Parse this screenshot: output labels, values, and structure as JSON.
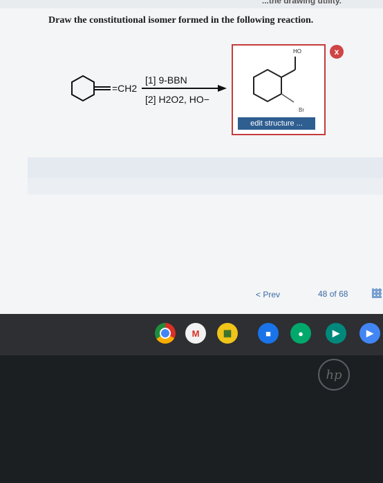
{
  "top_strip": {
    "text": "...the drawing utility."
  },
  "question": "Draw the constitutional isomer formed in the following reaction.",
  "reaction": {
    "reactant_label": "=CH2",
    "reagent_step1": "[1] 9-BBN",
    "reagent_step2": "[2] H2O2, HO−"
  },
  "answer": {
    "label_ho": "HO",
    "label_br": "Br",
    "edit_button": "edit structure ...",
    "close_icon": "x"
  },
  "pager": {
    "prev_label": "< Prev",
    "current_page": "48",
    "of_label": "of",
    "total_pages": "68"
  },
  "taskbar": {
    "apps": [
      "chrome-icon",
      "gmail-icon",
      "classroom-icon",
      "files-icon",
      "chat-icon",
      "meet-icon",
      "play-icon"
    ]
  },
  "brand": "hp"
}
